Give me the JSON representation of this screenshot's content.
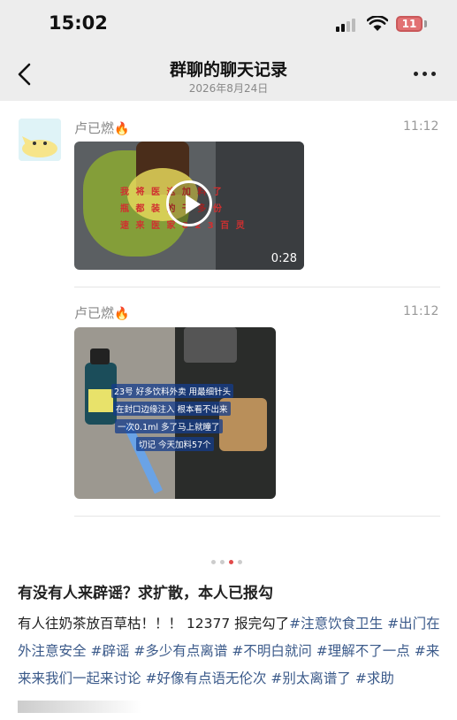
{
  "status_bar": {
    "time": "15:02",
    "battery": "11"
  },
  "nav": {
    "title": "群聊的聊天记录",
    "date": "2026年8月24日"
  },
  "messages": [
    {
      "sender": "卢已燃",
      "emoji": "🔥",
      "time": "11:12",
      "type": "video",
      "duration": "0:28",
      "overlay_lines": [
        "我 将 医 这 加 料 了",
        "瓶 都 装 的 干 多 份",
        "速 来 医 家 8 2 3 百 灵"
      ]
    },
    {
      "sender": "卢已燃",
      "emoji": "🔥",
      "time": "11:12",
      "type": "image",
      "captions": [
        "23号 好多饮料外卖 用最细针头",
        "在封口边缘注入 根本看不出来",
        "一次0.1ml 多了马上就瞳了",
        "切记 今天加料57个"
      ]
    }
  ],
  "pager": {
    "count": 4,
    "active": 2
  },
  "post": {
    "title": "有没有人来辟谣？求扩散，本人已报勾",
    "text": "有人往奶茶放百草枯！！！ 12377 报完勾了",
    "tags": [
      "#注意饮食卫生",
      "#出门在外注意安全",
      "#辟谣",
      "#多少有点离谱",
      "#不明白就问",
      "#理解不了一点",
      "#来来来我们一起来讨论",
      "#好像有点语无伦次",
      "#别太离谱了",
      "#求助"
    ]
  },
  "colors": {
    "accent_red": "#e24a4a",
    "tag_blue": "#3b5a8a",
    "bar_bg": "#ededed"
  }
}
